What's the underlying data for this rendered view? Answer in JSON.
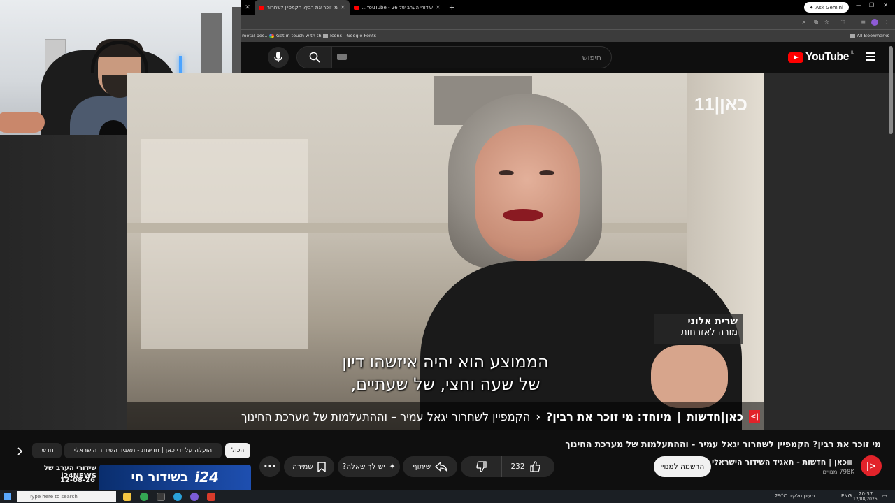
{
  "browser": {
    "tabs": [
      {
        "title": "מי זוכר את רבין? הקמפיין לשחרור"
      },
      {
        "title": "שידורי הערב של YouTube - 26..."
      }
    ],
    "new_tab_symbol": "+",
    "ask_gemini": "Ask Gemini",
    "bookmarks": [
      "metal pos...",
      "Get in touch with th...",
      "Icons - Google Fonts"
    ],
    "all_bookmarks": "All Bookmarks"
  },
  "youtube": {
    "logo_text": "YouTube",
    "country_code": "IL",
    "search_placeholder": "חיפוש"
  },
  "video": {
    "channel_watermark": "כאן|11",
    "speaker_name": "שרית אלוני",
    "speaker_role": "מורה לאזרחות",
    "subtitle_line1": "הממוצע הוא יהיה איזשהו דיון",
    "subtitle_line2": "של שעה וחצי, של שעתיים,",
    "ticker_brand": "כאן|חדשות",
    "ticker_special": "מיוחד: מי זוכר את רבין?",
    "ticker_text": "הקמפיין לשחרור יגאל עמיר – וההתעלמות של מערכת החינוך"
  },
  "details": {
    "title": "מי זוכר את רבין? הקמפיין לשחרור יגאל עמיר - וההתעלמות של מערכת החינוך",
    "channel_name": "כאן | חדשות - תאגיד השידור הישראלי",
    "subscribers": "798K מנויים",
    "subscribe_label": "הרשמה למנויי",
    "like_count": "232",
    "share_label": "שיתוף",
    "ask_label": "יש לך שאלה?",
    "save_label": "שמירה"
  },
  "rail": {
    "chips": [
      "הכול",
      "הועלה על ידי כאן | חדשות - תאגיד השידור הישראלי",
      "חדשו"
    ],
    "rec_title": "שידורי הערב של i24NEWS",
    "rec_date": "12-08-26",
    "rec_thumb_text": "בשידור חי",
    "rec_thumb_logo": "i24"
  },
  "taskbar": {
    "search_placeholder": "Type here to search",
    "weather": "29°C מעונן חלקית",
    "lang": "ENG",
    "time": "20:37",
    "date": "12/08/2026"
  },
  "colors": {
    "yt_red": "#ff0000",
    "kan_red": "#e2232a",
    "background": "#0f0f0f"
  }
}
